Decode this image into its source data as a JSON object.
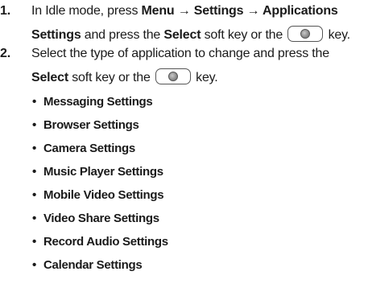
{
  "steps": [
    {
      "number": "1.",
      "line1": {
        "pre": "In Idle mode, press ",
        "bold": "Menu → Settings → Applications"
      },
      "line2": {
        "bold1": "Settings",
        "mid": " and press the ",
        "bold2": "Select",
        "post1": " soft key or the ",
        "post2": " key."
      },
      "key_icon": "center-select-key-icon"
    },
    {
      "number": "2.",
      "line1": {
        "pre": "Select the type of application to change and press the"
      },
      "line2": {
        "bold1": "Select",
        "post1": " soft key or the ",
        "post2": " key."
      },
      "key_icon": "center-select-key-icon"
    }
  ],
  "bullet_glyph": "•",
  "applications": [
    "Messaging Settings",
    "Browser Settings",
    "Camera Settings",
    "Music Player Settings",
    "Mobile Video Settings",
    "Video Share Settings",
    "Record Audio Settings",
    "Calendar Settings"
  ],
  "colors": {
    "text": "#1a1a1a",
    "background": "#ffffff"
  }
}
